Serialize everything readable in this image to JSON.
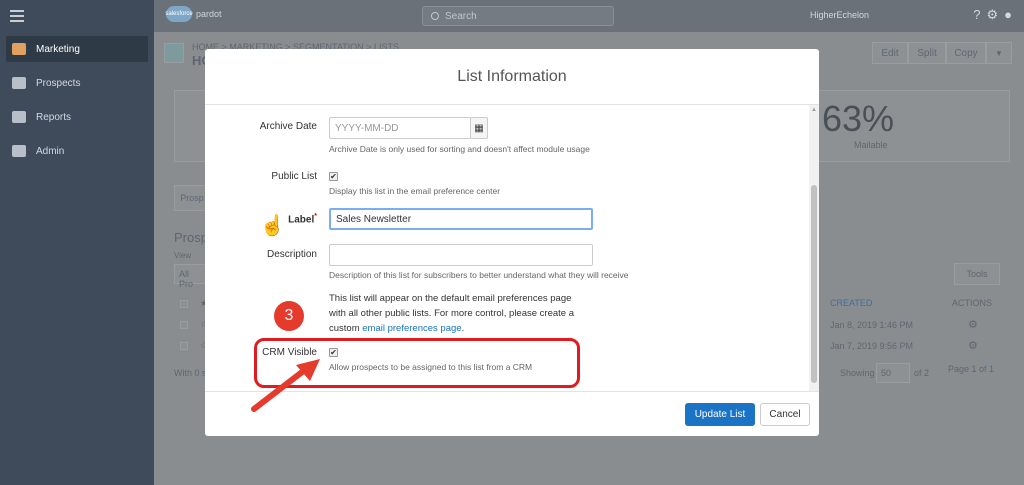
{
  "topbar": {
    "logo_text": "salesforce",
    "product": "pardot",
    "search_placeholder": "Search",
    "user": "HigherEchelon"
  },
  "sidebar": {
    "items": [
      {
        "label": "Marketing"
      },
      {
        "label": "Prospects"
      },
      {
        "label": "Reports"
      },
      {
        "label": "Admin"
      }
    ]
  },
  "background": {
    "breadcrumb": "HOME > MARKETING > SEGMENTATION > LISTS",
    "title": "HC",
    "header_buttons": [
      "Edit",
      "Split",
      "Copy"
    ],
    "stat_value": "63%",
    "stat_label": "Mailable",
    "tab": "Prosp",
    "section": "Prosp",
    "view": "View",
    "filter": "All Pro",
    "tools": "Tools",
    "col_created": "CREATED",
    "col_actions": "ACTIONS",
    "rows": [
      "Jan 8, 2019 1:46 PM",
      "Jan 7, 2019 9:56 PM"
    ],
    "with": "With 0 s",
    "showing": "Showing",
    "per_page": "50",
    "of": "of 2",
    "page_info": "Page 1 of",
    "page_link": "1"
  },
  "modal": {
    "title": "List Information",
    "archive_label": "Archive Date",
    "archive_placeholder": "YYYY-MM-DD",
    "archive_help": "Archive Date is only used for sorting and doesn't affect module usage",
    "public_label": "Public List",
    "public_help": "Display this list in the email preference center",
    "label_label": "Label",
    "required_mark": "*",
    "label_value": "Sales Newsletter",
    "desc_label": "Description",
    "desc_help": "Description of this list for subscribers to better understand what they will receive",
    "public_note_1": "This list will appear on the default email preferences page",
    "public_note_2": "with all other public lists. For more control, please create a",
    "public_note_3": "custom",
    "public_note_link": "email preferences page",
    "public_note_end": ".",
    "crm_label": "CRM Visible",
    "crm_help": "Allow prospects to be assigned to this list from a CRM",
    "update_button": "Update List",
    "cancel_button": "Cancel"
  },
  "annotation": {
    "step": "3",
    "color": "#e11b22"
  }
}
